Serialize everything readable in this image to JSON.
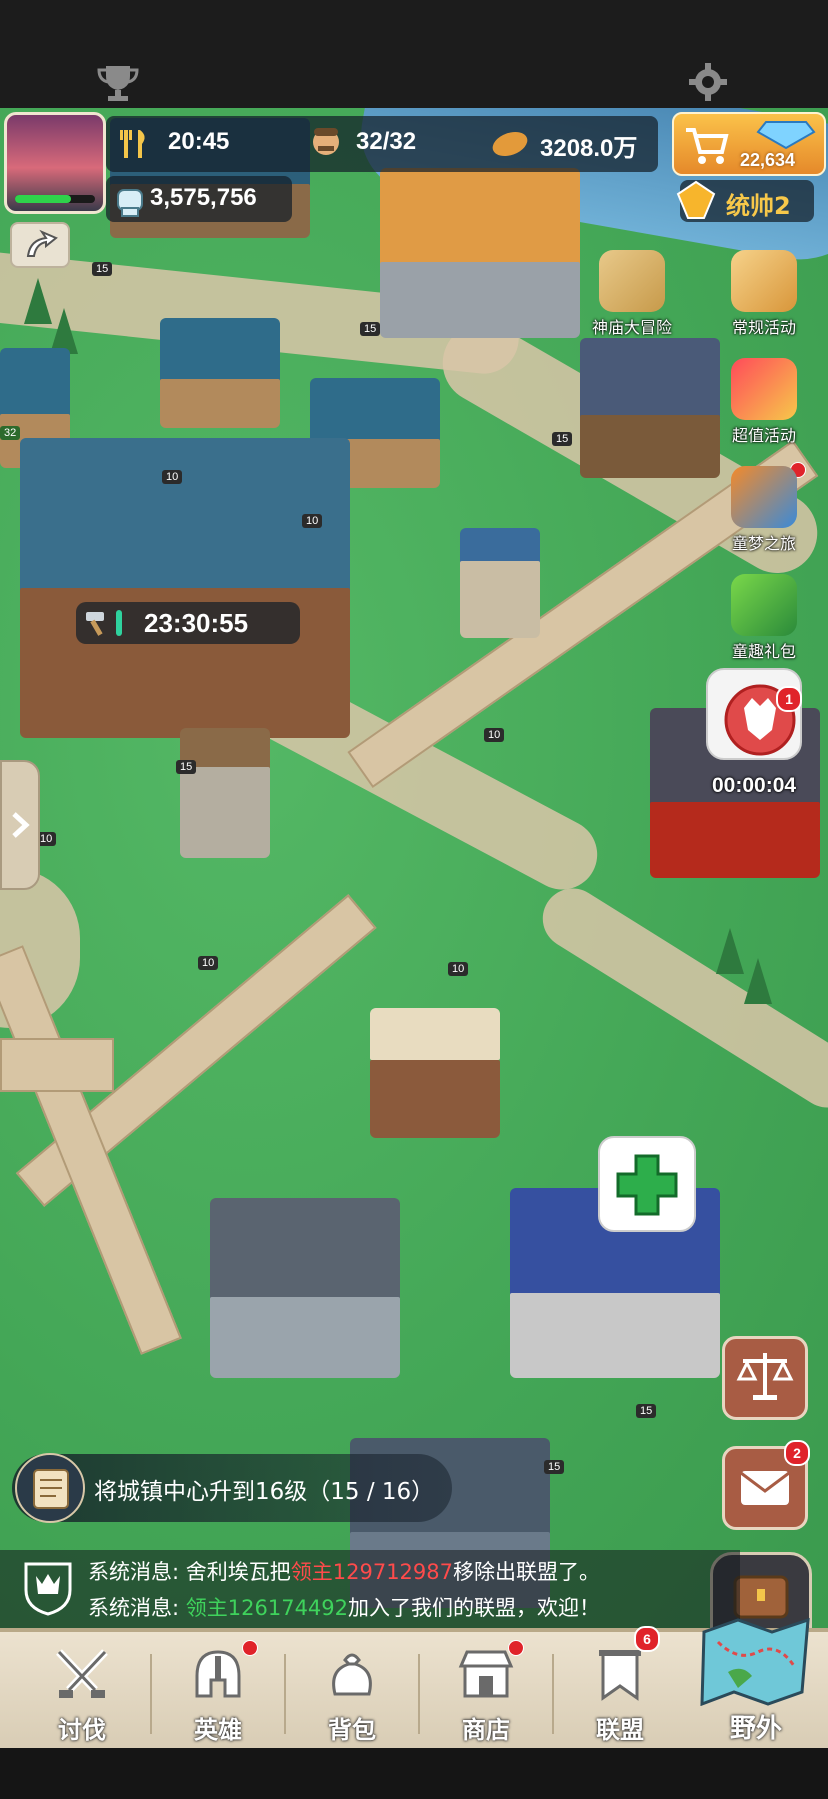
{
  "topbar": {
    "trophy_icon": "trophy-icon",
    "settings_icon": "gear-icon"
  },
  "resources": {
    "food": "20:45",
    "population": "32/32",
    "bread": "3208.0万",
    "power": "3,575,756",
    "gems": "22,634"
  },
  "commander": {
    "label": "统帅2"
  },
  "timers": {
    "build_timer": "23:30:55",
    "attack_timer": "00:00:04"
  },
  "events": [
    {
      "label": "神庙大冒险",
      "icon": "treasure-map-icon"
    },
    {
      "label": "常规活动",
      "icon": "scroll-icon"
    },
    {
      "label": "超值活动",
      "icon": "gift-icon"
    },
    {
      "label": "童梦之旅",
      "icon": "carousel-icon"
    },
    {
      "label": "童趣礼包",
      "icon": "dragon-gift-icon"
    }
  ],
  "badges": {
    "attack": "1",
    "mail": "2",
    "alliance": "6"
  },
  "building_levels": [
    "15",
    "15",
    "15",
    "10",
    "10",
    "15",
    "10",
    "10",
    "10",
    "15",
    "32",
    "15",
    "10"
  ],
  "quest": {
    "text": "将城镇中心升到16级（15 / 16）"
  },
  "chat": {
    "line1_prefix": "系统消息: 舍利埃瓦把",
    "line1_name": "领主129712987",
    "line1_suffix": "移除出联盟了。",
    "line2_prefix": "系统消息: ",
    "line2_name": "领主126174492",
    "line2_suffix": "加入了我们的联盟，欢迎！"
  },
  "nav": [
    {
      "label": "讨伐",
      "icon": "crossed-swords-icon"
    },
    {
      "label": "英雄",
      "icon": "helmet-icon"
    },
    {
      "label": "背包",
      "icon": "bag-icon"
    },
    {
      "label": "商店",
      "icon": "shop-icon"
    },
    {
      "label": "联盟",
      "icon": "banner-icon"
    },
    {
      "label": "野外",
      "icon": "world-map-icon"
    }
  ],
  "colors": {
    "accent_gold": "#f3a92a",
    "red_badge": "#e0232a",
    "grass": "#43a656",
    "chat_red": "#ff4b4b",
    "chat_green": "#3fd35c"
  }
}
